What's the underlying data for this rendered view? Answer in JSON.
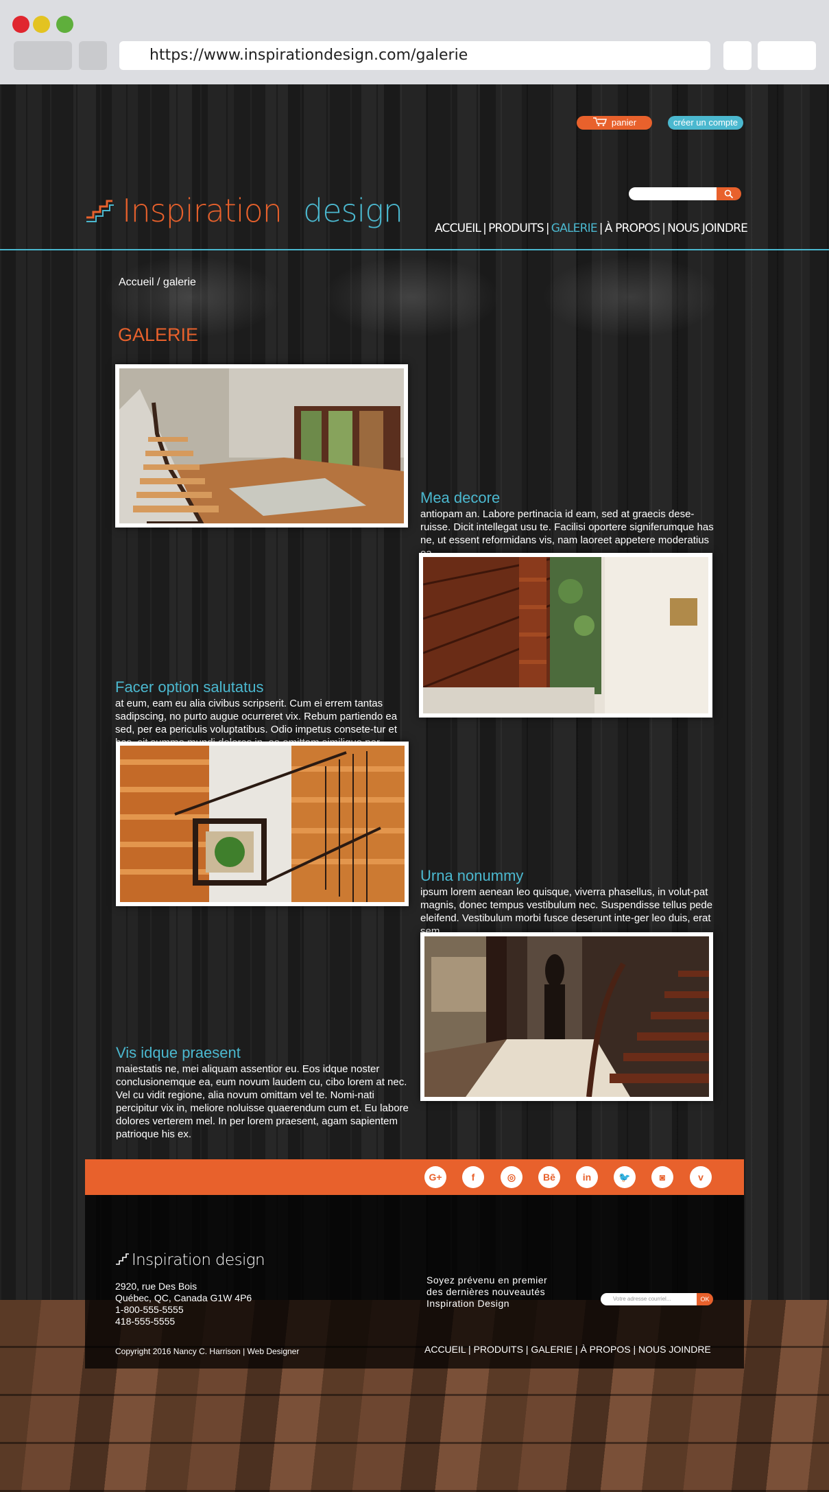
{
  "browser": {
    "url": "https://www.inspirationdesign.com/galerie"
  },
  "header": {
    "cart_label": "panier",
    "account_label": "créer un compte",
    "logo_text": "Inspiration design",
    "nav": [
      "ACCUEIL",
      "PRODUITS",
      "GALERIE",
      "À PROPOS",
      "NOUS JOINDRE"
    ],
    "nav_active": "GALERIE"
  },
  "breadcrumb": "Accueil / galerie",
  "page_title": "GALERIE",
  "items": [
    {
      "title": "Mea decore",
      "text": "antiopam an. Labore pertinacia id eam, sed at graecis dese-ruisse. Dicit intellegat usu te. Facilisi oportere signiferumque has ne, ut essent reformidans vis, nam laoreet appetere moderatius ea."
    },
    {
      "title": "Facer option salutatus",
      "text": "at eum, eam eu alia civibus scripserit. Cum ei errem tantas sadipscing, no purto augue ocurreret vix. Rebum partiendo ea sed, per ea periculis voluptatibus. Odio impetus consete-tur et has, sit summo mundi dolores in, ea omittam similique per."
    },
    {
      "title": "Urna nonummy",
      "text": "ipsum lorem aenean leo quisque, viverra phasellus, in volut-pat magnis, donec tempus vestibulum nec. Suspendisse tellus pede eleifend. Vestibulum morbi fusce deserunt inte-ger leo duis, erat sem."
    },
    {
      "title": "Vis idque praesent",
      "text": "maiestatis ne, mei aliquam assentior eu. Eos idque noster conclusionemque ea, eum novum laudem cu, cibo lorem at nec. Vel cu vidit regione, alia novum omittam vel te. Nomi-nati percipitur vix in, meliore noluisse quaerendum cum et. Eu labore dolores verterem mel. In per lorem praesent, agam sapientem patrioque his ex."
    }
  ],
  "social": [
    "G+",
    "f",
    "◎",
    "Bē",
    "in",
    "🐦",
    "◙",
    "v"
  ],
  "footer": {
    "logo_text": "Inspiration design",
    "address": [
      "2920, rue Des Bois",
      "Québec, QC, Canada G1W 4P6",
      "1-800-555-5555",
      "418-555-5555"
    ],
    "newsletter": [
      "Soyez prévenu en premier",
      "des dernières nouveautés",
      "Inspiration Design"
    ],
    "newsletter_placeholder": "Votre adresse courriel...",
    "newsletter_button": "OK",
    "nav": "ACCUEIL | PRODUITS | GALERIE | À PROPOS | NOUS JOINDRE",
    "copyright": "Copyright 2016 Nancy C. Harrison | Web Designer"
  },
  "colors": {
    "accent_orange": "#e8612c",
    "accent_blue": "#4bb8cf"
  }
}
